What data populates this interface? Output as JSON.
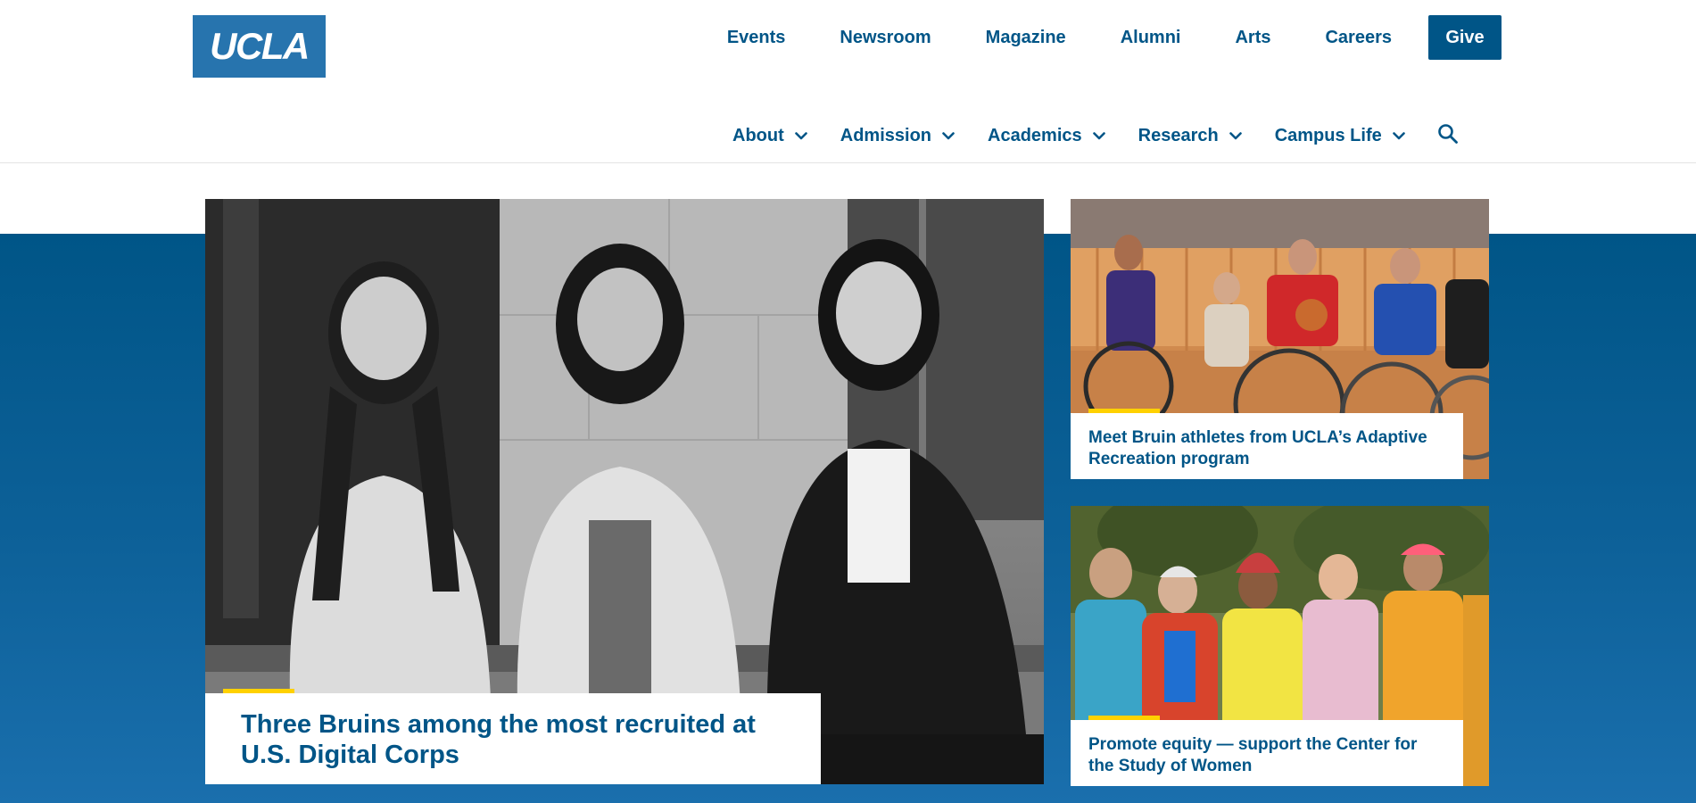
{
  "logo": {
    "text": "UCLA"
  },
  "utility_nav": [
    "Events",
    "Newsroom",
    "Magazine",
    "Alumni",
    "Arts",
    "Careers"
  ],
  "give_label": "Give",
  "main_nav": [
    "About",
    "Admission",
    "Academics",
    "Research",
    "Campus Life"
  ],
  "hero": {
    "feature": {
      "title": "Three Bruins among the most recruited at U.S. Digital Corps"
    },
    "side_stories": [
      {
        "title": "Meet Bruin athletes from UCLA’s Adaptive Recreation program"
      },
      {
        "title": "Promote equity — support the Center for the Study of Women"
      }
    ]
  },
  "colors": {
    "ucla_blue": "#2774AE",
    "darker_blue": "#005587",
    "ucla_gold": "#FFD100"
  },
  "icons": {
    "dropdown": "chevron-down-icon",
    "search": "search-icon"
  }
}
